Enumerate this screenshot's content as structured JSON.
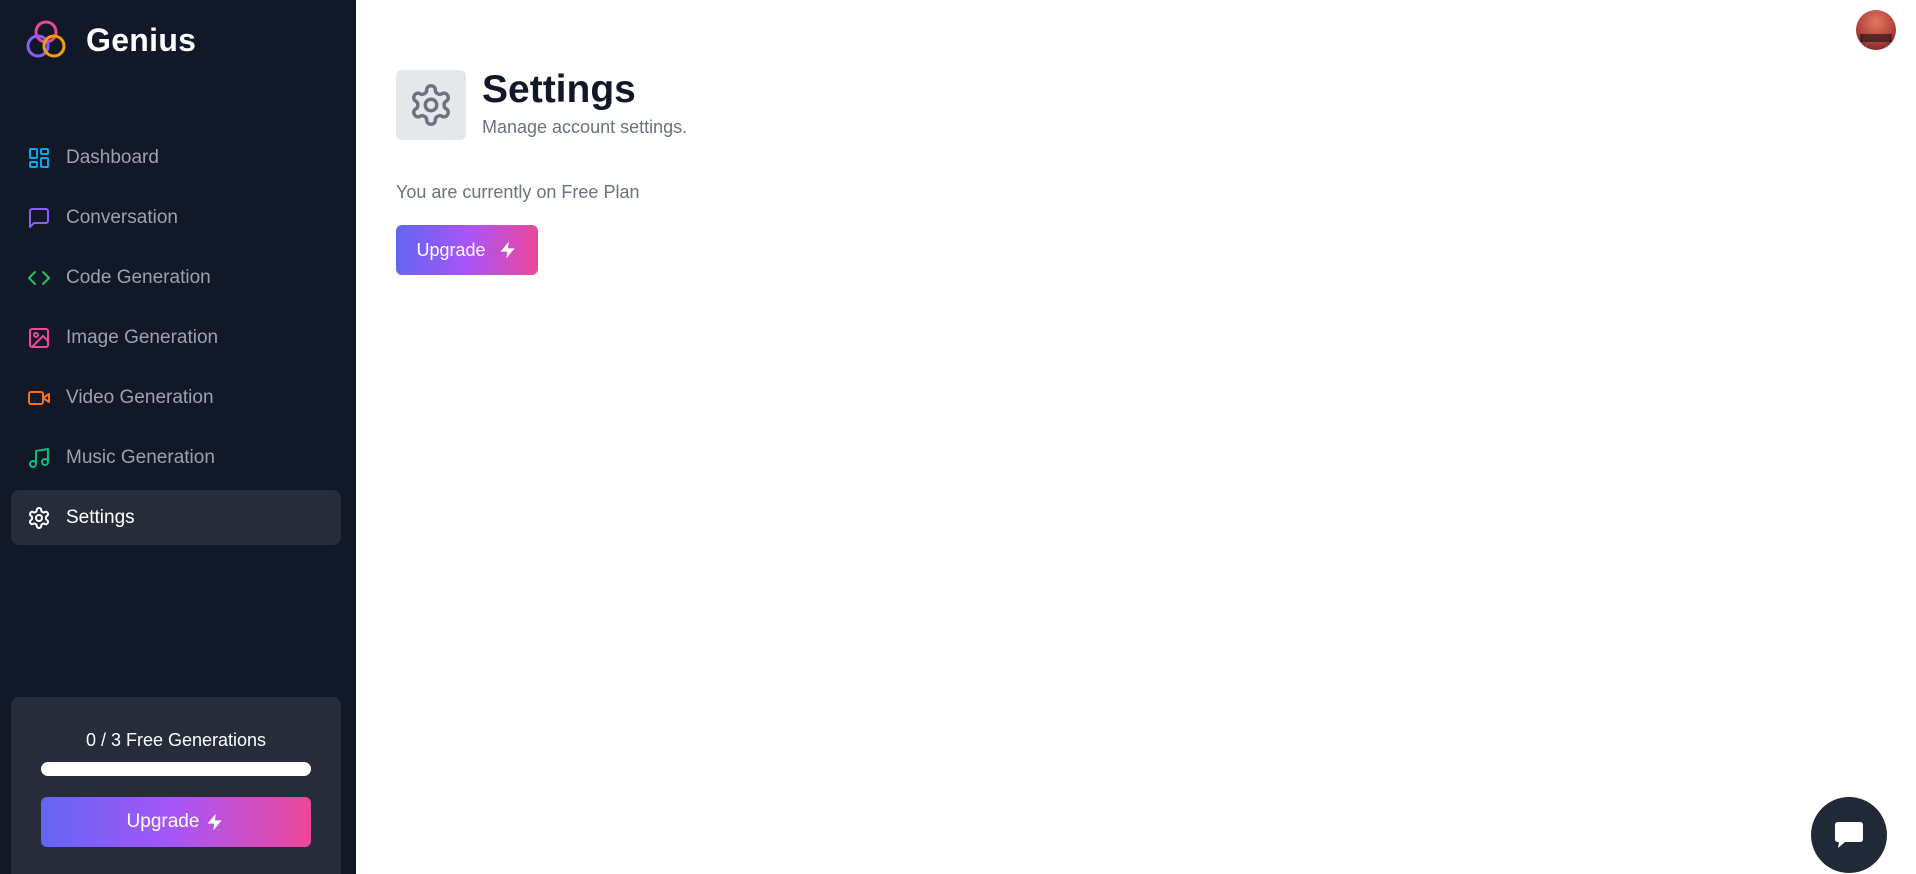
{
  "brand": {
    "name": "Genius"
  },
  "sidebar": {
    "items": [
      {
        "label": "Dashboard",
        "icon": "dashboard-icon",
        "color": "#0ea5e9"
      },
      {
        "label": "Conversation",
        "icon": "message-square-icon",
        "color": "#8b5cf6"
      },
      {
        "label": "Code Generation",
        "icon": "code-icon",
        "color": "#22c55e"
      },
      {
        "label": "Image Generation",
        "icon": "image-icon",
        "color": "#ec4899"
      },
      {
        "label": "Video Generation",
        "icon": "video-icon",
        "color": "#f97316"
      },
      {
        "label": "Music Generation",
        "icon": "music-icon",
        "color": "#10b981"
      },
      {
        "label": "Settings",
        "icon": "settings-icon",
        "color": "#ffffff",
        "active": true
      }
    ],
    "usage": {
      "count_text": "0 / 3 Free Generations",
      "used": 0,
      "limit": 3,
      "upgrade_label": "Upgrade"
    }
  },
  "header": {
    "title": "Settings",
    "subtitle": "Manage account settings.",
    "icon": "settings-icon"
  },
  "main": {
    "plan_text": "You are currently on Free Plan",
    "upgrade_label": "Upgrade"
  },
  "colors": {
    "sidebar_bg": "#111827",
    "active_item_bg": "#262c3a",
    "gradient_start": "#6366f1",
    "gradient_end": "#ec4899"
  }
}
